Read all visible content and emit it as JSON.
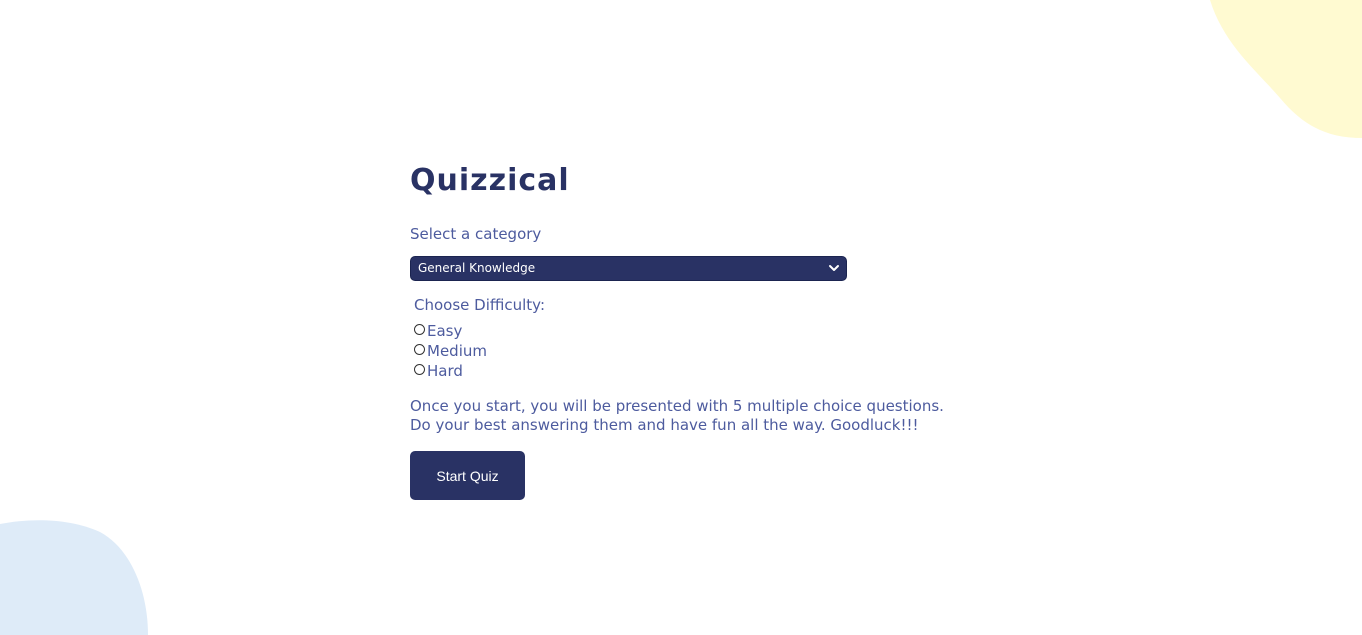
{
  "app": {
    "title": "Quizzical"
  },
  "category": {
    "label": "Select a category",
    "selected": "General Knowledge"
  },
  "difficulty": {
    "label": "Choose Difficulty:",
    "options": [
      "Easy",
      "Medium",
      "Hard"
    ],
    "selected": null
  },
  "description": "Once you start, you will be presented with 5 multiple choice questions. Do your best answering them and have fun all the way. Goodluck!!!",
  "start_button": {
    "label": "Start Quiz"
  },
  "colors": {
    "primary": "#293264",
    "text": "#4d5b9e",
    "blob_yellow": "#fffad1",
    "blob_blue": "#deebf8"
  }
}
